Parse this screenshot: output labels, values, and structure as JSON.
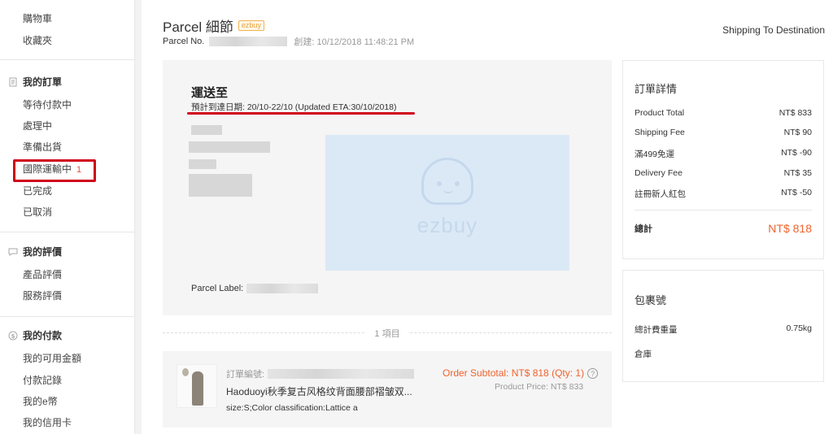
{
  "sidebar": {
    "top_links": [
      "購物車",
      "收藏夾"
    ],
    "orders": {
      "heading": "我的訂單",
      "items": [
        "等待付款中",
        "處理中",
        "準備出貨",
        "國際運輸中",
        "已完成",
        "已取消"
      ],
      "in_transit_count": "1"
    },
    "reviews": {
      "heading": "我的評價",
      "items": [
        "產品評價",
        "服務評價"
      ]
    },
    "payments": {
      "heading": "我的付款",
      "items": [
        "我的可用金額",
        "付款記錄",
        "我的e幣",
        "我的信用卡"
      ]
    }
  },
  "header": {
    "title": "Parcel 細節",
    "badge": "ezbuy",
    "parcel_no_label": "Parcel No.",
    "created": "創建: 10/12/2018 11:48:21 PM",
    "status": "Shipping To Destination"
  },
  "shipping": {
    "title": "運送至",
    "eta": "預計到達日期: 20/10-22/10 (Updated ETA:30/10/2018)",
    "map_logo": "ezbuy",
    "parcel_label": "Parcel Label:"
  },
  "items": {
    "count_label": "1 項目",
    "order_no_label": "訂單編號:",
    "product_name": "Haoduoyi秋季复古风格纹背面腰部褶皱双...",
    "product_attr": "size:S;Color classification:Lattice a",
    "subtotal": "Order Subtotal: NT$ 818 (Qty: 1)",
    "help_icon": "?",
    "product_price": "Product Price: NT$ 833"
  },
  "order_details": {
    "title": "訂單詳情",
    "rows": [
      {
        "label": "Product Total",
        "value": "NT$ 833"
      },
      {
        "label": "Shipping Fee",
        "value": "NT$ 90"
      },
      {
        "label": "滿499免運",
        "value": "NT$ -90"
      },
      {
        "label": "Delivery Fee",
        "value": "NT$ 35"
      },
      {
        "label": "註冊新人紅包",
        "value": "NT$ -50"
      }
    ],
    "total_label": "總計",
    "total_value": "NT$ 818"
  },
  "package": {
    "title": "包裹號",
    "weight_label": "總計費重量",
    "weight_value": "0.75kg",
    "warehouse_label": "倉庫"
  },
  "colors": {
    "accent": "#f0632d",
    "annotation": "#d0021b"
  }
}
